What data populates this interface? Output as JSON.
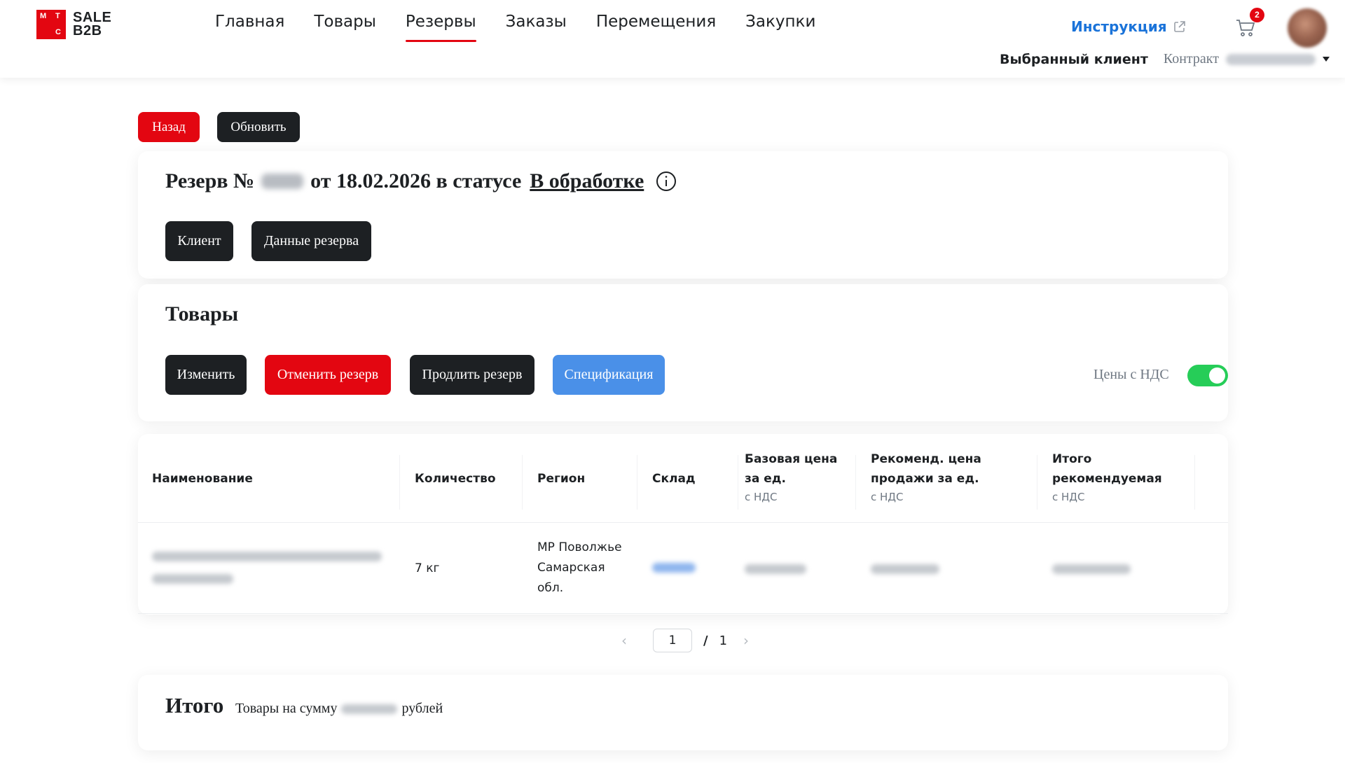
{
  "header": {
    "logo_letters": [
      "М",
      "Т",
      "С"
    ],
    "logo_text_1": "SALE",
    "logo_text_2": "B2B",
    "nav": [
      "Главная",
      "Товары",
      "Резервы",
      "Заказы",
      "Перемещения",
      "Закупки"
    ],
    "active_nav": "Резервы",
    "instruction_link": "Инструкция",
    "cart_count": "2",
    "selected_client_label": "Выбранный клиент",
    "contract_label": "Контракт"
  },
  "actions": {
    "back": "Назад",
    "refresh": "Обновить"
  },
  "reserve": {
    "title_prefix": "Резерв №",
    "title_date": "от 18.02.2026 в статусе",
    "status": "В обработке",
    "client_button": "Клиент",
    "data_button": "Данные резерва"
  },
  "goods": {
    "title": "Товары",
    "edit_button": "Изменить",
    "cancel_button": "Отменить резерв",
    "extend_button": "Продлить резерв",
    "spec_button": "Спецификация",
    "vat_toggle_label": "Цены с НДС",
    "vat_toggle_on": true
  },
  "table": {
    "columns": {
      "name": "Наименование",
      "quantity": "Количество",
      "region": "Регион",
      "warehouse": "Склад",
      "base_price": "Базовая цена за ед.",
      "base_price_sub": "с НДС",
      "recommended_price": "Рекоменд. цена продажи за ед.",
      "recommended_price_sub": "с НДС",
      "total_recommended": "Итого рекомендуемая",
      "total_recommended_sub": "с НДС"
    },
    "rows": [
      {
        "quantity": "7 кг",
        "region_lines": [
          "МР Поволжье",
          "Самарская",
          "обл."
        ]
      }
    ]
  },
  "pagination": {
    "current_page": "1",
    "separator": "/",
    "total_pages": "1"
  },
  "total": {
    "title": "Итого",
    "prefix": "Товары на сумму",
    "suffix": "рублей"
  },
  "colors": {
    "brand_red": "#e30611",
    "dark_button": "#1d2023",
    "spec_blue": "#4a90e8",
    "toggle_green": "#26cd58",
    "link_blue": "#1a73d9"
  },
  "icons": [
    "external-link-icon",
    "cart-icon",
    "info-icon",
    "chevron-left-icon",
    "chevron-right-icon",
    "caret-down-icon"
  ]
}
